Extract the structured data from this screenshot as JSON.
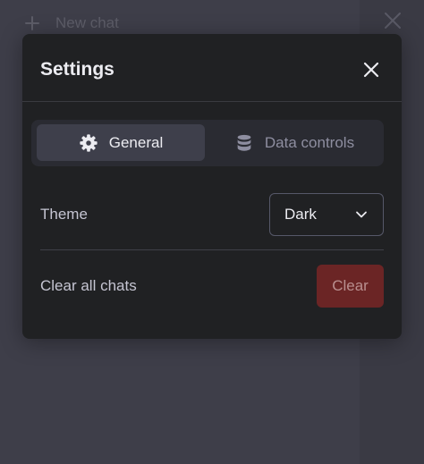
{
  "background": {
    "new_chat_label": "New chat",
    "icons": {
      "plus": "plus-icon",
      "close": "close-icon"
    }
  },
  "modal": {
    "title": "Settings",
    "close_icon": "close-icon",
    "tabs": [
      {
        "label": "General",
        "icon": "gear-icon",
        "active": true
      },
      {
        "label": "Data controls",
        "icon": "database-icon",
        "active": false
      }
    ],
    "theme": {
      "label": "Theme",
      "selected": "Dark"
    },
    "clear_chats": {
      "label": "Clear all chats",
      "button_label": "Clear"
    }
  },
  "colors": {
    "modal_bg": "#202123",
    "backdrop": "#34343f",
    "active_tab": "#3e3f4b",
    "danger": "#6b2525"
  }
}
